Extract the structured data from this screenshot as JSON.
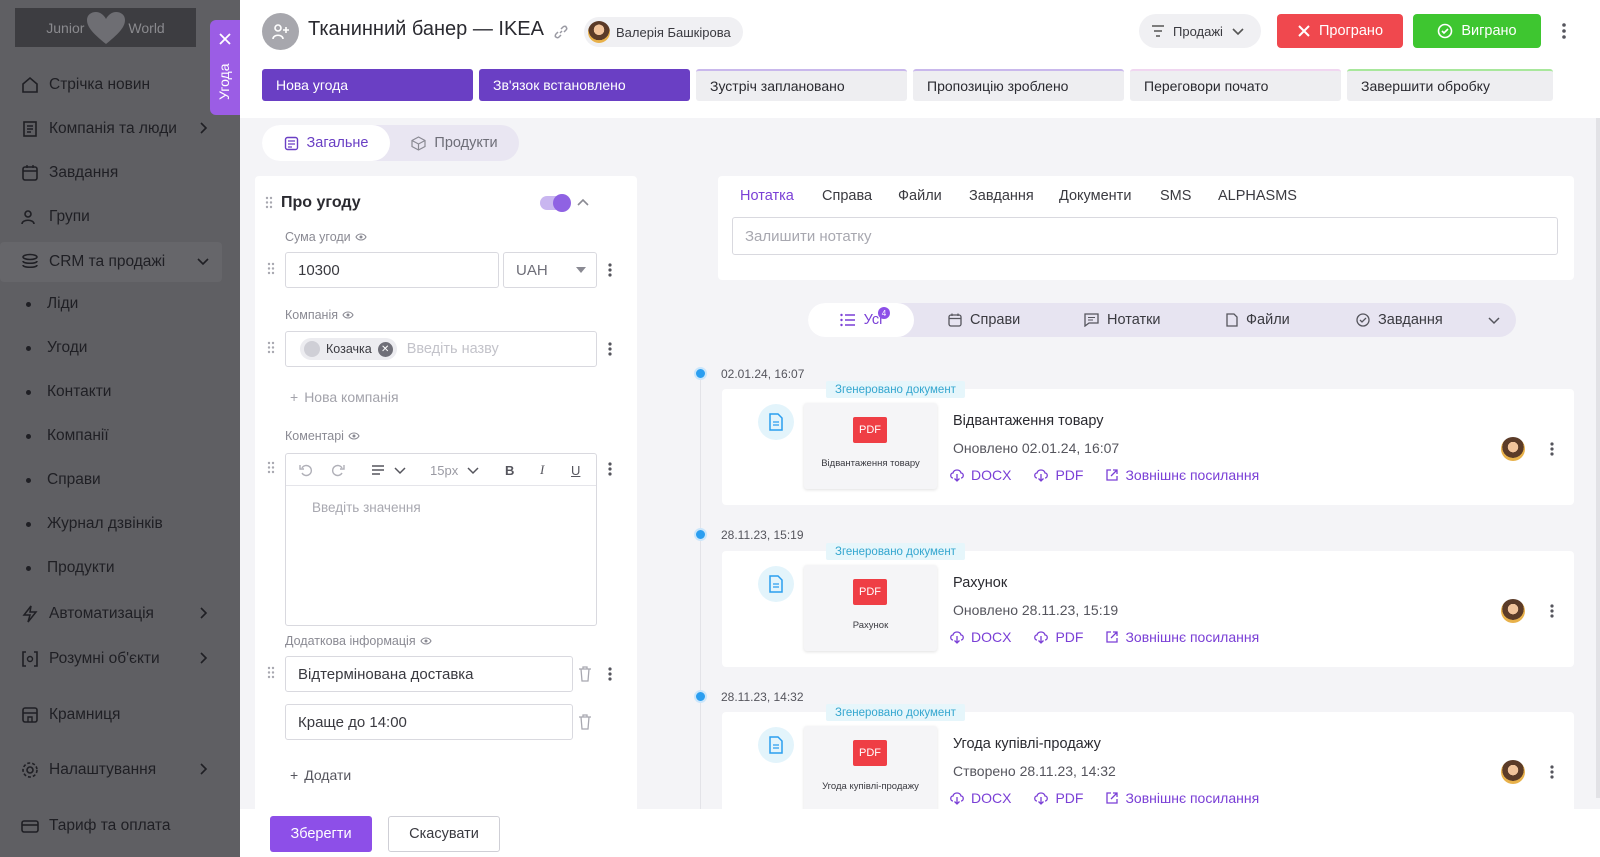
{
  "sidebar": {
    "logo_left": "Junior",
    "logo_right": "World",
    "items": [
      {
        "label": "Стрічка новин",
        "icon": "home-icon"
      },
      {
        "label": "Компанія та люди",
        "icon": "book-icon"
      },
      {
        "label": "Завдання",
        "icon": "calendar-icon"
      },
      {
        "label": "Групи",
        "icon": "users-icon"
      },
      {
        "label": "CRM та продажі",
        "icon": "stack-icon"
      },
      {
        "label": "Автоматизація",
        "icon": "bolt-icon"
      },
      {
        "label": "Розумні об'єкти",
        "icon": "brackets-icon"
      },
      {
        "label": "Крамниця",
        "icon": "store-icon"
      },
      {
        "label": "Налаштування",
        "icon": "gear-icon"
      },
      {
        "label": "Тариф та оплата",
        "icon": "card-icon"
      }
    ],
    "crm_sub": [
      "Ліди",
      "Угоди",
      "Контакти",
      "Компанії",
      "Справи",
      "Журнал дзвінків",
      "Продукти"
    ]
  },
  "drawer_tab": {
    "label": "Угода"
  },
  "header": {
    "title": "Тканинний банер — IKEA",
    "owner": "Валерія Башкірова",
    "funnel": "Продажі",
    "lost_label": "Програно",
    "won_label": "Виграно"
  },
  "stages": [
    {
      "label": "Нова угода",
      "done": true
    },
    {
      "label": "Зв'язок встановлено",
      "done": true
    },
    {
      "label": "Зустріч заплановано",
      "done": false,
      "accent": "#c9b8ec"
    },
    {
      "label": "Пропозицію зроблено",
      "done": false,
      "accent": "#c9b8ec"
    },
    {
      "label": "Переговори почато",
      "done": false,
      "accent": "#f0d6f0"
    },
    {
      "label": "Завершити обробку",
      "done": false,
      "accent": "#a8e79c"
    }
  ],
  "subtabs": {
    "general": "Загальне",
    "products": "Продукти"
  },
  "about": {
    "title": "Про угоду",
    "amount_label": "Сума угоди",
    "amount_value": "10300",
    "currency": "UAH",
    "company_label": "Компанія",
    "company_chip": "Козачка",
    "company_placeholder": "Введіть назву",
    "add_company": "Нова компанія",
    "comments_label": "Коментарі",
    "font_size": "15px",
    "comments_placeholder": "Введіть значення",
    "extra_label": "Додаткова інформація",
    "extra_values": [
      "Відтермінована доставка",
      "Краще до 14:00"
    ],
    "add_label": "Додати"
  },
  "footer": {
    "save": "Зберегти",
    "cancel": "Скасувати"
  },
  "note_tabs": [
    "Нотатка",
    "Справа",
    "Файли",
    "Завдання",
    "Документи",
    "SMS",
    "ALPHASMS"
  ],
  "note_placeholder": "Залишити нотатку",
  "filters": {
    "all": "Усі",
    "all_count": "4",
    "cases": "Справи",
    "notes": "Нотатки",
    "files": "Файли",
    "tasks": "Завдання"
  },
  "timeline": [
    {
      "date": "02.01.24, 16:07",
      "tag": "Згенеровано документ",
      "title": "Відвантаження товару",
      "sub": "Оновлено 02.01.24, 16:07",
      "thumb_caption": "Відвантаження товару"
    },
    {
      "date": "28.11.23, 15:19",
      "tag": "Згенеровано документ",
      "title": "Рахунок",
      "sub": "Оновлено 28.11.23, 15:19",
      "thumb_caption": "Рахунок"
    },
    {
      "date": "28.11.23, 14:32",
      "tag": "Згенеровано документ",
      "title": "Угода купівлі-продажу",
      "sub": "Створено 28.11.23, 14:32",
      "thumb_caption": "Угода купівлі-продажу"
    }
  ],
  "event_links": {
    "docx": "DOCX",
    "pdf": "PDF",
    "external": "Зовнішнє посилання"
  },
  "pdf_badge": "PDF"
}
